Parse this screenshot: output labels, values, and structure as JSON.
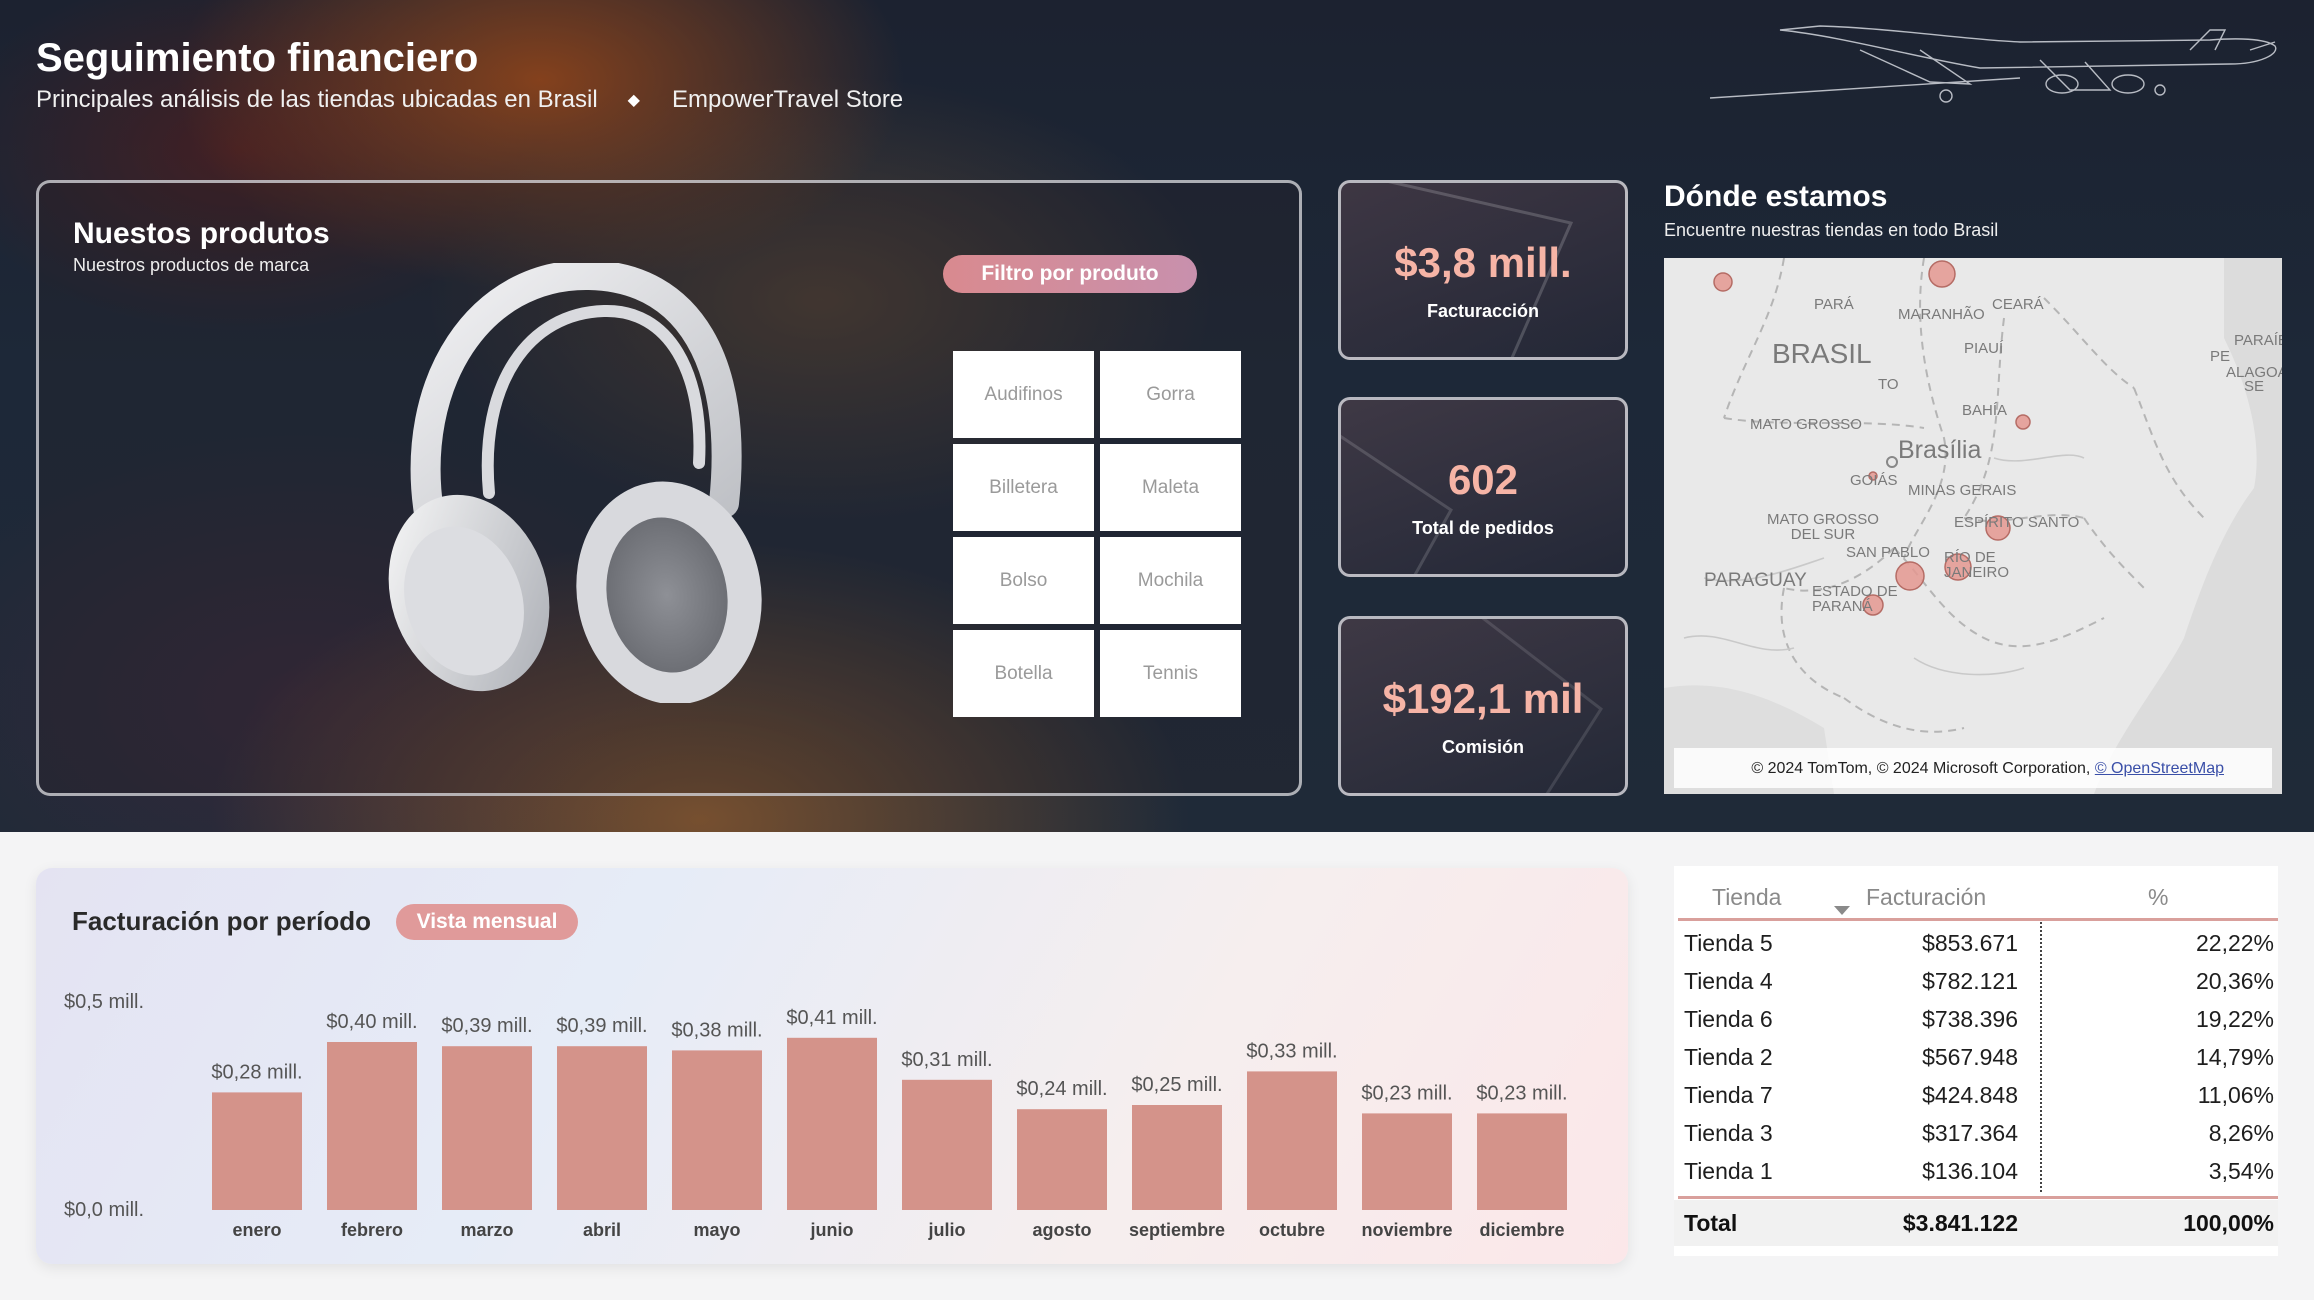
{
  "header": {
    "title": "Seguimiento financiero",
    "subtitle": "Principales análisis de las tiendas ubicadas en Brasil",
    "separator": "◆",
    "store": "EmpowerTravel Store"
  },
  "products": {
    "title": "Nuestos produtos",
    "subtitle": "Nuestros productos de marca",
    "filter_label": "Filtro por produto",
    "items": [
      "Audifinos",
      "Gorra",
      "Billetera",
      "Maleta",
      "Bolso",
      "Mochila",
      "Botella",
      "Tennis"
    ]
  },
  "kpis": [
    {
      "value": "$3,8 mill.",
      "label": "Facturacción"
    },
    {
      "value": "602",
      "label": "Total de pedidos"
    },
    {
      "value": "$192,1 mil",
      "label": "Comisión"
    }
  ],
  "map": {
    "title": "Dónde estamos",
    "subtitle": "Encuentre nuestras tiendas en todo Brasil",
    "labels": [
      "PARÁ",
      "MARANHÃO",
      "CEARÁ",
      "BRASIL",
      "PIAUÍ",
      "PARAÍBA",
      "PE",
      "ALAGOAS",
      "SE",
      "TO",
      "BAHÍA",
      "MATO GROSSO",
      "Brasília",
      "GOIÁS",
      "MINAS GERAIS",
      "MATO GROSSO DEL SUR",
      "ESPÍRITO SANTO",
      "SAN PABLO",
      "RÍO DE JANEIRO",
      "PARAGUAY",
      "ESTADO DE PARANÁ"
    ],
    "credit": "© 2024 TomTom, © 2024 Microsoft Corporation,",
    "credit_link": "© OpenStreetMap"
  },
  "chart": {
    "title": "Facturación por período",
    "view_label": "Vista mensual"
  },
  "chart_data": {
    "type": "bar",
    "title": "Facturación por período",
    "categories": [
      "enero",
      "febrero",
      "marzo",
      "abril",
      "mayo",
      "junio",
      "julio",
      "agosto",
      "septiembre",
      "octubre",
      "noviembre",
      "diciembre"
    ],
    "values": [
      0.28,
      0.4,
      0.39,
      0.39,
      0.38,
      0.41,
      0.31,
      0.24,
      0.25,
      0.33,
      0.23,
      0.23
    ],
    "data_labels": [
      "$0,28 mill.",
      "$0,40 mill.",
      "$0,39 mill.",
      "$0,39 mill.",
      "$0,38 mill.",
      "$0,41 mill.",
      "$0,31 mill.",
      "$0,24 mill.",
      "$0,25 mill.",
      "$0,33 mill.",
      "$0,23 mill.",
      "$0,23 mill."
    ],
    "ytick_labels": [
      "$0,0 mill.",
      "$0,5 mill."
    ],
    "ylim": [
      0,
      0.5
    ],
    "bar_color": "#d4938a",
    "grid": false
  },
  "table": {
    "headers": [
      "Tienda",
      "Facturación",
      "%"
    ],
    "rows": [
      {
        "tienda": "Tienda 5",
        "facturacion": "$853.671",
        "pct": "22,22%"
      },
      {
        "tienda": "Tienda 4",
        "facturacion": "$782.121",
        "pct": "20,36%"
      },
      {
        "tienda": "Tienda 6",
        "facturacion": "$738.396",
        "pct": "19,22%"
      },
      {
        "tienda": "Tienda 2",
        "facturacion": "$567.948",
        "pct": "14,79%"
      },
      {
        "tienda": "Tienda 7",
        "facturacion": "$424.848",
        "pct": "11,06%"
      },
      {
        "tienda": "Tienda 3",
        "facturacion": "$317.364",
        "pct": "8,26%"
      },
      {
        "tienda": "Tienda 1",
        "facturacion": "$136.104",
        "pct": "3,54%"
      }
    ],
    "total": {
      "label": "Total",
      "facturacion": "$3.841.122",
      "pct": "100,00%"
    }
  }
}
